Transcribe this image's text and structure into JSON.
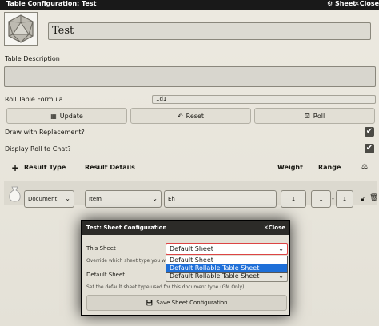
{
  "window": {
    "title": "Table Configuration: Test",
    "sheet_label": "Sheet",
    "close_label": "Close"
  },
  "table": {
    "name": "Test",
    "description_label": "Table Description",
    "formula_label": "Roll Table Formula",
    "formula_value": "1d1",
    "update_label": "Update",
    "reset_label": "Reset",
    "roll_label": "Roll",
    "replacement_label": "Draw with Replacement?",
    "display_roll_label": "Display Roll to Chat?",
    "replacement_checked": true,
    "display_roll_checked": true
  },
  "results": {
    "headers": {
      "add": "+",
      "type": "Result Type",
      "details": "Result Details",
      "weight": "Weight",
      "range": "Range"
    },
    "rows": [
      {
        "type": "Document",
        "collection": "Item",
        "text": "Eh",
        "weight": "1",
        "range_low": "1",
        "range_sep": "-",
        "range_high": "1"
      }
    ]
  },
  "dialog": {
    "title": "Test: Sheet Configuration",
    "close_label": "Close",
    "this_sheet_label": "This Sheet",
    "this_sheet_value": "Default Sheet",
    "this_sheet_hint": "Override which sheet type you wo",
    "default_sheet_label": "Default Sheet",
    "default_sheet_value": "Default Rollable Table Sheet",
    "default_sheet_hint": "Set the default sheet type used for this document type (GM Only).",
    "options": [
      "Default Sheet",
      "Default Rollable Table Sheet"
    ],
    "save_label": "Save Sheet Configuration"
  },
  "colors": {
    "titlebar": "#191919",
    "dropdown_highlight": "#1e6fd8",
    "focus_border": "#dd4444"
  }
}
